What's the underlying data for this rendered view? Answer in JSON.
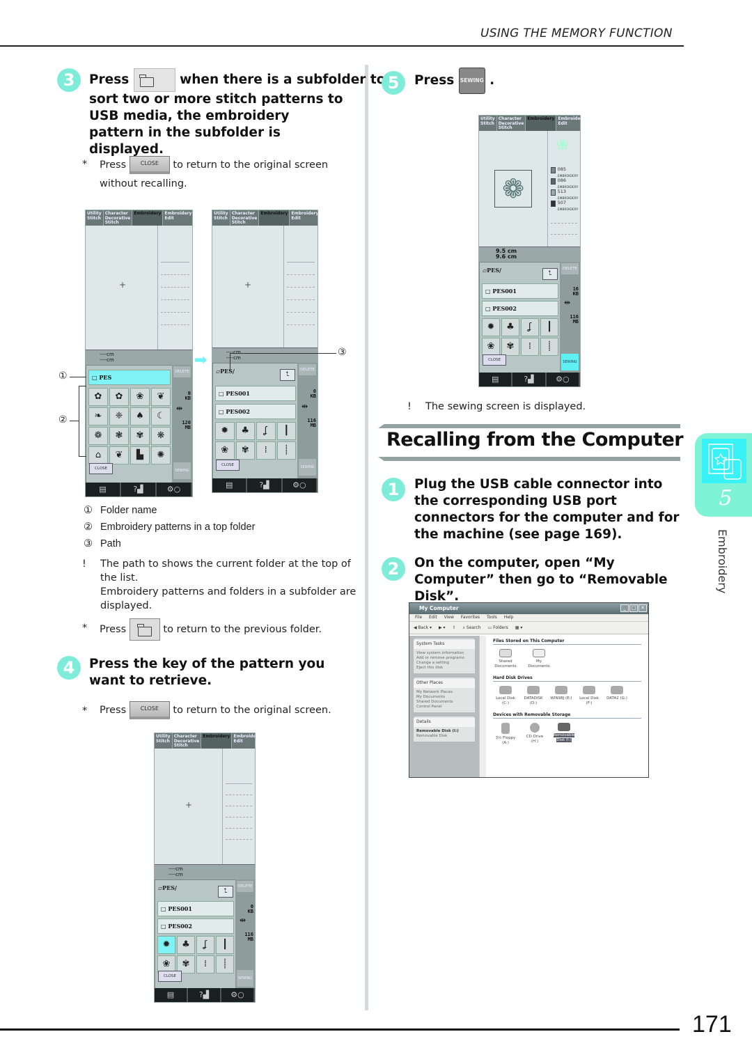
{
  "header": {
    "running_head": "USING THE MEMORY FUNCTION"
  },
  "left_column": {
    "step3": {
      "number": "3",
      "press": "Press",
      "text_after_button": "when there is a subfolder to",
      "text_continued": "sort two or more stitch patterns to USB media, the embroidery pattern in the subfolder is displayed.",
      "note_bullet": "*",
      "note_press": "Press",
      "note_button": "CLOSE",
      "note_text": "to return to the original screen without recalling."
    },
    "callouts": {
      "c1": "①",
      "c2": "②",
      "c3": "③"
    },
    "legend": [
      {
        "mark": "①",
        "label": "Folder name"
      },
      {
        "mark": "②",
        "label": "Embroidery patterns in a top folder"
      },
      {
        "mark": "③",
        "label": "Path"
      }
    ],
    "info_note": {
      "bullet": "!",
      "line1": "The path to shows the current folder at the top of the list.",
      "line2": "Embroidery patterns and folders in a subfolder are displayed."
    },
    "prev_folder_note": {
      "bullet": "*",
      "press": "Press",
      "text": "to return to the previous folder."
    },
    "step4": {
      "number": "4",
      "text": "Press the key of the pattern you want to retrieve.",
      "note_bullet": "*",
      "note_press": "Press",
      "note_button": "CLOSE",
      "note_text": "to return to the original screen."
    }
  },
  "machine_screen": {
    "tabs": [
      "Utility Stitch",
      "Character Decorative Stitch",
      "Embroidery",
      "Embroidery Edit"
    ],
    "size_placeholder_w": "----cm",
    "size_placeholder_h": "----cm",
    "delete_label": "DELETE",
    "close_label": "CLOSE",
    "sewing_label": "SEWING",
    "screen1": {
      "folder": "PES",
      "kb": "0",
      "kb_unit": "KB",
      "mb": "120",
      "mb_unit": "MB"
    },
    "screen2": {
      "path": "PES/",
      "folders": [
        "PES001",
        "PES002"
      ],
      "kb": "0",
      "kb_unit": "KB",
      "mb": "116",
      "mb_unit": "MB"
    },
    "screen3": {
      "path": "PES/",
      "folders": [
        "PES001",
        "PES002"
      ],
      "kb": "16",
      "kb_unit": "KB",
      "mb": "116",
      "mb_unit": "MB",
      "size_w": "9.5 cm",
      "size_h": "9.6 cm",
      "threads": [
        {
          "code": "085",
          "type": "EMBROIDERY"
        },
        {
          "code": "086",
          "type": "EMBROIDERY"
        },
        {
          "code": "513",
          "type": "EMBROIDERY"
        },
        {
          "code": "507",
          "type": "EMBROIDERY"
        }
      ]
    },
    "bottom_icons": [
      "document-icon",
      "help-machine-icon",
      "settings-icon"
    ]
  },
  "right_column": {
    "step5": {
      "number": "5",
      "press": "Press",
      "button": "SEWING",
      "period": "."
    },
    "step5_note": {
      "bullet": "!",
      "text": "The sewing screen is displayed."
    },
    "section_title": "Recalling from the Computer",
    "step1": {
      "number": "1",
      "text": "Plug the USB cable connector into the corresponding USB port connectors for the computer and for the machine (see page 169)."
    },
    "step2": {
      "number": "2",
      "text": "On the computer, open “My Computer” then go to “Removable Disk”."
    }
  },
  "explorer_window": {
    "title": "My Computer",
    "menu": [
      "File",
      "Edit",
      "View",
      "Favorites",
      "Tools",
      "Help"
    ],
    "toolbar": [
      "Back",
      "Search",
      "Folders"
    ],
    "system_tasks": {
      "title": "System Tasks",
      "items": [
        "View system information",
        "Add or remove programs",
        "Change a setting",
        "Eject this disk"
      ]
    },
    "other_places": {
      "title": "Other Places",
      "items": [
        "My Network Places",
        "My Documents",
        "Shared Documents",
        "Control Panel"
      ]
    },
    "details": {
      "title": "Details",
      "name": "Removable Disk (I:)",
      "type": "Removable Disk"
    },
    "groups": [
      {
        "title": "Files Stored on This Computer",
        "items": [
          "Shared Documents",
          "My Documents"
        ]
      },
      {
        "title": "Hard Disk Drives",
        "items": [
          "Local Disk (C:)",
          "DATADISK (D:)",
          "WIN98J (E:)",
          "Local Disk (F:)",
          "DATA2 (G:)"
        ]
      },
      {
        "title": "Devices with Removable Storage",
        "items": [
          "3½ Floppy (A:)",
          "CD Drive (H:)",
          "Removable Disk (I:)"
        ]
      }
    ],
    "selected_item": "Removable Disk (I:)"
  },
  "chapter_tab": {
    "number": "5",
    "label": "Embroidery"
  },
  "footer": {
    "page_number": "171"
  },
  "colors": {
    "accent": "#7eecd8",
    "cyan": "#38f2f8",
    "rule_gray": "#93a3a0"
  }
}
